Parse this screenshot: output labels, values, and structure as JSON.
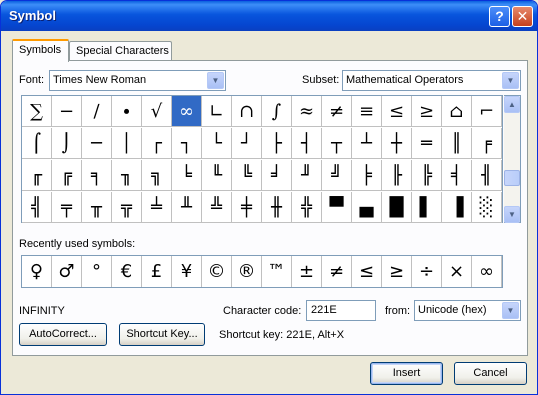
{
  "window": {
    "title": "Symbol",
    "help_btn": "?",
    "close_btn": "✕"
  },
  "tabs": [
    {
      "label": "Symbols",
      "active": true
    },
    {
      "label": "Special Characters",
      "active": false
    }
  ],
  "font": {
    "label": "Font:",
    "value": "Times New Roman"
  },
  "subset": {
    "label": "Subset:",
    "value": "Mathematical Operators"
  },
  "symbol_grid": [
    [
      "∑",
      "−",
      "∕",
      "∙",
      "√",
      "∞",
      "∟",
      "∩",
      "∫",
      "≈",
      "≠",
      "≡",
      "≤",
      "≥",
      "⌂",
      "⌐"
    ],
    [
      "⌠",
      "⌡",
      "─",
      "│",
      "┌",
      "┐",
      "└",
      "┘",
      "├",
      "┤",
      "┬",
      "┴",
      "┼",
      "═",
      "║",
      "╒"
    ],
    [
      "╓",
      "╔",
      "╕",
      "╖",
      "╗",
      "╘",
      "╙",
      "╚",
      "╛",
      "╜",
      "╝",
      "╞",
      "╟",
      "╠",
      "╡",
      "╢"
    ],
    [
      "╣",
      "╤",
      "╥",
      "╦",
      "╧",
      "╨",
      "╩",
      "╪",
      "╫",
      "╬",
      "▀",
      "▄",
      "█",
      "▌",
      "▐",
      "░"
    ]
  ],
  "selected_symbol": "∞",
  "recent": {
    "label": "Recently used symbols:",
    "items": [
      "♀",
      "♂",
      "°",
      "€",
      "£",
      "¥",
      "©",
      "®",
      "™",
      "±",
      "≠",
      "≤",
      "≥",
      "÷",
      "×",
      "∞"
    ]
  },
  "char_name": "INFINITY",
  "char_code": {
    "label": "Character code:",
    "value": "221E"
  },
  "from": {
    "label": "from:",
    "value": "Unicode (hex)"
  },
  "buttons": {
    "autocorrect": "AutoCorrect...",
    "shortcut_key": "Shortcut Key...",
    "insert": "Insert",
    "cancel": "Cancel"
  },
  "shortcut_text": "Shortcut key: 221E, Alt+X"
}
